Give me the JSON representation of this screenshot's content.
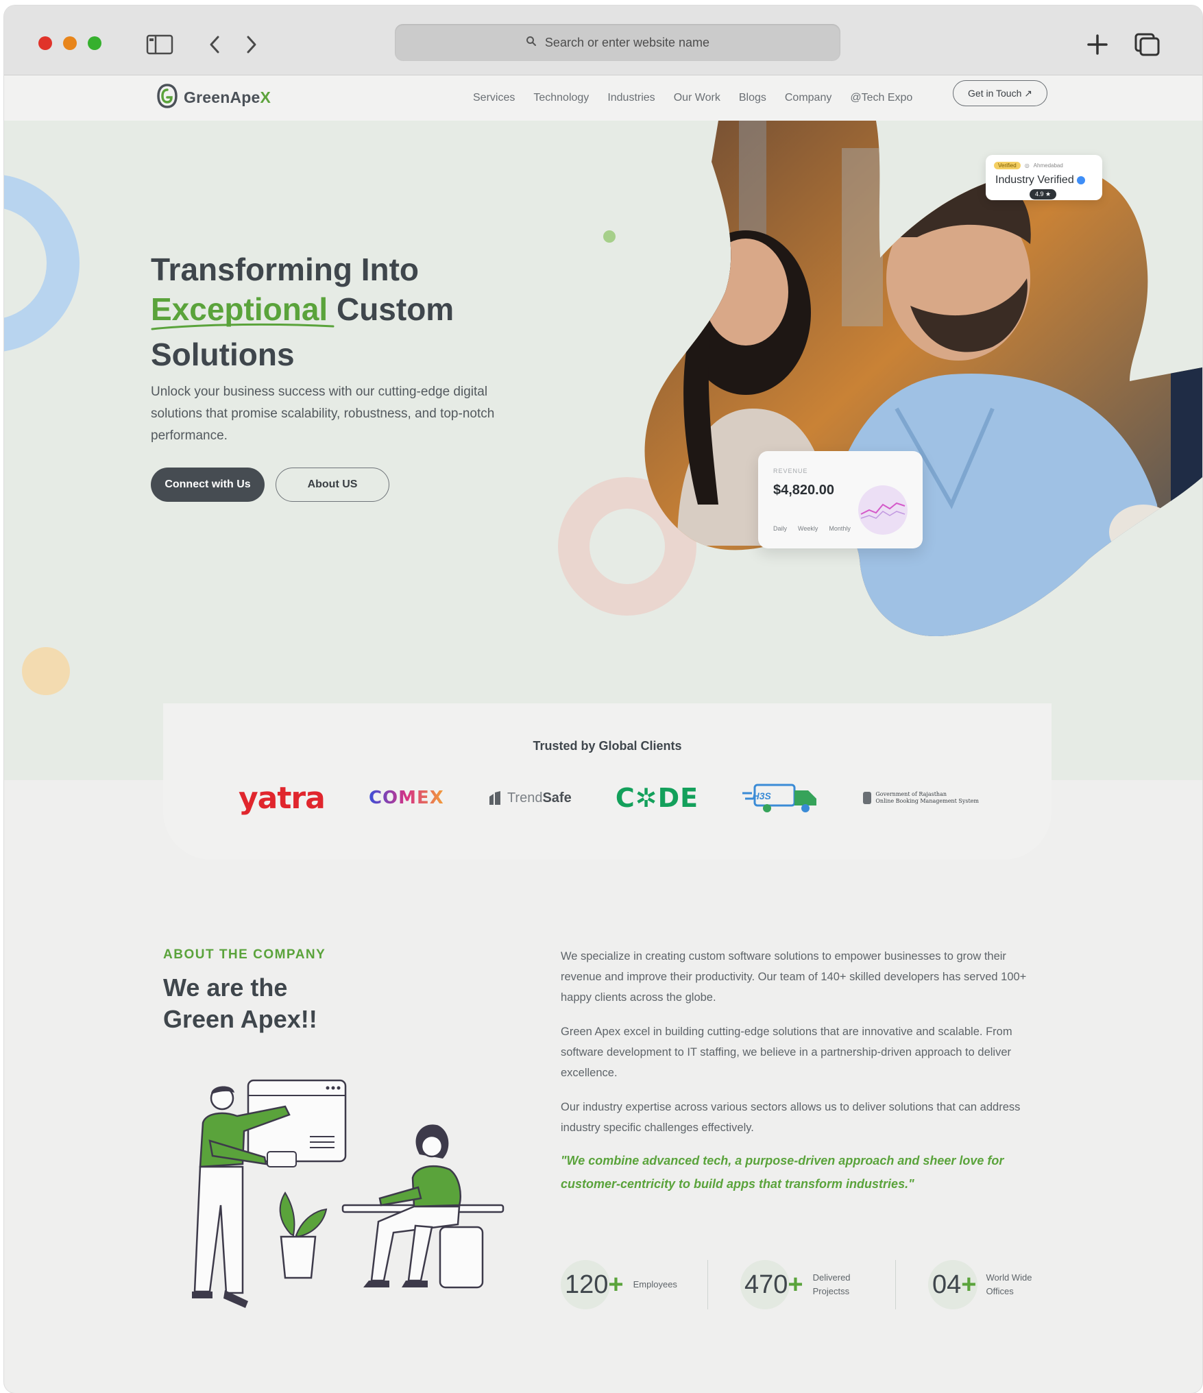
{
  "browser": {
    "url_placeholder": "Search or enter website name"
  },
  "site": {
    "logo_text": "GreenApe",
    "logo_accent": "X",
    "nav": [
      "Services",
      "Technology",
      "Industries",
      "Our Work",
      "Blogs",
      "Company",
      "@Tech Expo"
    ],
    "cta": "Get in Touch ↗"
  },
  "hero": {
    "title_line1": "Transforming Into",
    "title_green": "Exceptional",
    "title_line2_rest": " Custom",
    "title_line3": "Solutions",
    "description": "Unlock your business success with our cutting-edge digital solutions that promise scalability, robustness, and top-notch performance.",
    "primary_button": "Connect with Us",
    "secondary_button": "About US",
    "badge": {
      "pill": "Verified",
      "location": "Ahmedabad",
      "title": "Industry Verified",
      "rating": "4.9 ★"
    },
    "revenue_card": {
      "label": "REVENUE",
      "value": "$4,820.00",
      "tabs": [
        "Daily",
        "Weekly",
        "Monthly"
      ]
    }
  },
  "clients": {
    "title": "Trusted by Global Clients",
    "logos": {
      "yatra": "yatra",
      "comex": "COMEX",
      "trendsafe_a": "Trend",
      "trendsafe_b": "Safe",
      "code": "C✲DE",
      "h3s": "H3S",
      "gov_line1": "Government of Rajasthan",
      "gov_line2": "Online Booking Management System"
    }
  },
  "about": {
    "eyebrow": "ABOUT THE COMPANY",
    "title_line1": "We are the",
    "title_line2": "Green Apex!!",
    "paragraphs": [
      "We specialize in creating custom software solutions to empower businesses to grow their revenue and improve their productivity. Our team of 140+ skilled developers has served 100+ happy clients across the globe.",
      "Green Apex excel in building cutting-edge solutions that are innovative and scalable. From software development to IT staffing, we believe in a partnership-driven approach to deliver excellence.",
      "Our industry expertise across various sectors allows us to deliver solutions that can address industry specific challenges effectively."
    ],
    "quote": "\"We combine advanced tech, a purpose-driven approach and sheer love for customer-centricity to build apps that transform industries.\"",
    "stats": [
      {
        "number": "120",
        "plus": "+",
        "label": "Employees"
      },
      {
        "number": "470",
        "plus": "+",
        "label": "Delivered\nProjectss"
      },
      {
        "number": "04",
        "plus": "+",
        "label": "World Wide\nOffices"
      }
    ]
  },
  "colors": {
    "brand_green": "#5aa33b",
    "dark_button": "#464c52",
    "hero_bg": "#e6ebe5"
  }
}
